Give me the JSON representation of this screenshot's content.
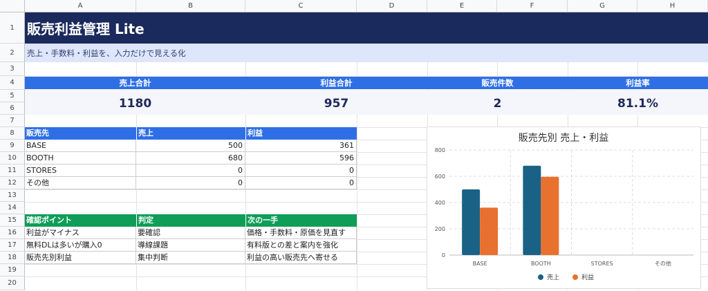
{
  "columns": [
    "A",
    "B",
    "C",
    "D",
    "E",
    "F",
    "G",
    "H"
  ],
  "rows": [
    "1",
    "2",
    "3",
    "4",
    "5",
    "6",
    "7",
    "8",
    "9",
    "10",
    "11",
    "12",
    "13",
    "14",
    "15",
    "16",
    "17",
    "18",
    "19",
    "20"
  ],
  "title": "販売利益管理 Lite",
  "subtitle": "売上・手数料・利益を、入力だけで見える化",
  "kpi": {
    "labels": [
      "売上合計",
      "利益合計",
      "販売件数",
      "利益率"
    ],
    "values": [
      "1180",
      "957",
      "2",
      "81.1%"
    ]
  },
  "sales_table": {
    "headers": [
      "販売先",
      "売上",
      "利益"
    ],
    "rows": [
      [
        "BASE",
        "500",
        "361"
      ],
      [
        "BOOTH",
        "680",
        "596"
      ],
      [
        "STORES",
        "0",
        "0"
      ],
      [
        "その他",
        "0",
        "0"
      ]
    ]
  },
  "check_table": {
    "headers": [
      "確認ポイント",
      "判定",
      "次の一手"
    ],
    "rows": [
      [
        "利益がマイナス",
        "要確認",
        "価格・手数料・原価を見直す"
      ],
      [
        "無料DLは多いが購入0",
        "導線課題",
        "有料版との差と案内を強化"
      ],
      [
        "販売先別利益",
        "集中判断",
        "利益の高い販売先へ寄せる"
      ]
    ]
  },
  "colors": {
    "title_bg": "#1b2a5c",
    "accent_blue": "#2f6fe6",
    "accent_green": "#0f9d58",
    "series_sales": "#1a6285",
    "series_profit": "#e8712f"
  },
  "chart_data": {
    "type": "bar",
    "title": "販売先別 売上・利益",
    "categories": [
      "BASE",
      "BOOTH",
      "STORES",
      "その他"
    ],
    "series": [
      {
        "name": "売上",
        "values": [
          500,
          680,
          0,
          0
        ]
      },
      {
        "name": "利益",
        "values": [
          361,
          596,
          0,
          0
        ]
      }
    ],
    "ylim": [
      0,
      800
    ],
    "yticks": [
      0,
      200,
      400,
      600,
      800
    ],
    "grid": true,
    "legend": "bottom"
  }
}
